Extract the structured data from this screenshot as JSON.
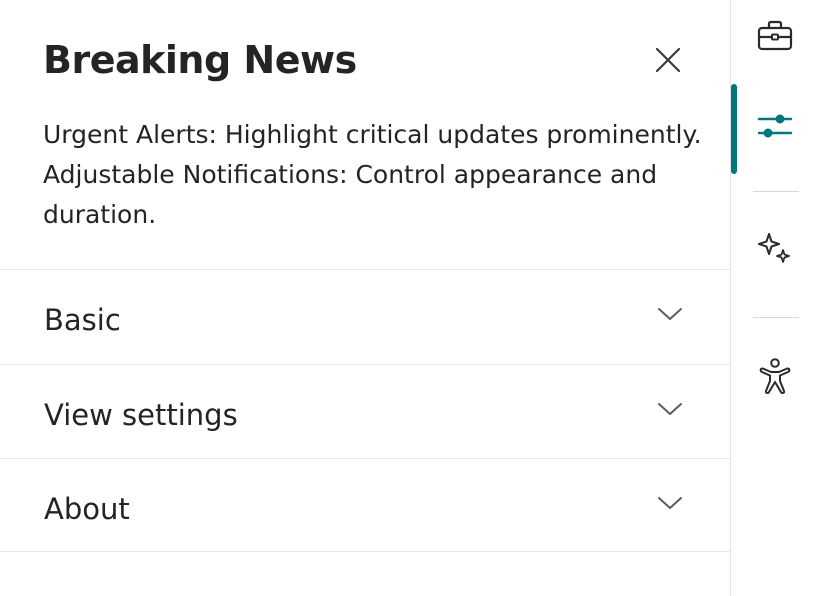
{
  "pane": {
    "title": "Breaking News",
    "description": "Urgent Alerts: Highlight critical updates prominently. Adjustable Notifications: Control appearance and duration.",
    "close_icon": "close-icon",
    "sections": [
      {
        "label": "Basic",
        "icon": "chevron-down-icon",
        "expanded": false
      },
      {
        "label": "View settings",
        "icon": "chevron-down-icon",
        "expanded": false
      },
      {
        "label": "About",
        "icon": "chevron-down-icon",
        "expanded": false
      }
    ]
  },
  "rail": {
    "items": [
      {
        "icon": "toolbox-icon",
        "active": false
      },
      {
        "icon": "sliders-icon",
        "active": true
      },
      {
        "icon": "sparkle-icon",
        "active": false
      },
      {
        "icon": "accessibility-icon",
        "active": false
      }
    ]
  },
  "colors": {
    "accent": "#03787c",
    "text": "#242424",
    "divider": "#e6e6e6"
  }
}
